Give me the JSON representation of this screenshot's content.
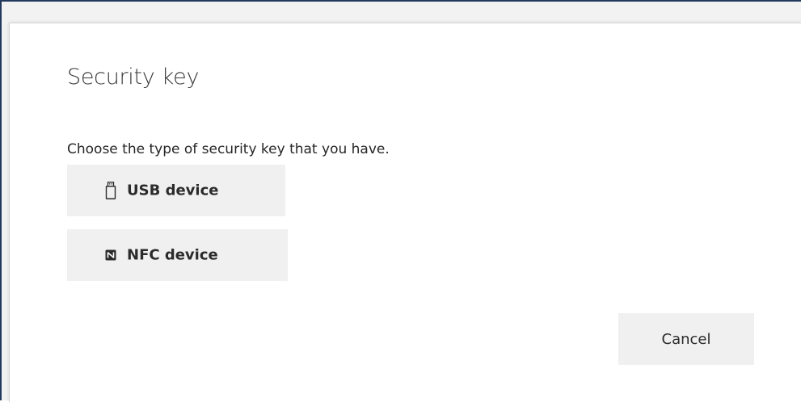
{
  "dialog": {
    "title": "Security key",
    "prompt": "Choose the type of security key that you have.",
    "options": [
      {
        "label": "USB device",
        "icon": "usb-drive-icon"
      },
      {
        "label": "NFC device",
        "icon": "nfc-icon"
      }
    ],
    "cancel_label": "Cancel"
  },
  "colors": {
    "window_border": "#233a5e",
    "button_background": "#f0f0f0",
    "text": "#262626"
  }
}
